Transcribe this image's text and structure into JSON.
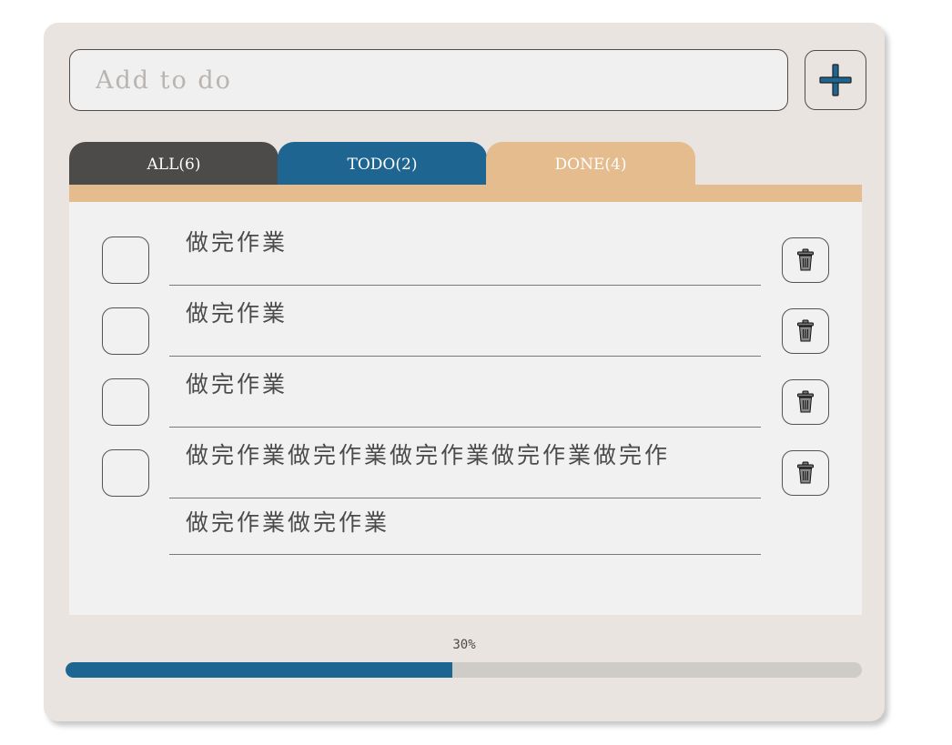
{
  "input": {
    "placeholder": "Add to do",
    "value": ""
  },
  "add_button": {
    "icon": "plus-icon"
  },
  "tabs": [
    {
      "label": "ALL(6)",
      "color": "#4d4b49"
    },
    {
      "label": "TODO(2)",
      "color": "#1e6592"
    },
    {
      "label": "DONE(4)",
      "color": "#e4bc8d"
    }
  ],
  "todos": [
    {
      "lines": [
        "做完作業"
      ],
      "checked": false
    },
    {
      "lines": [
        "做完作業"
      ],
      "checked": false
    },
    {
      "lines": [
        "做完作業"
      ],
      "checked": false
    },
    {
      "lines": [
        "做完作業做完作業做完作業做完作業做完作",
        "做完作業做完作業"
      ],
      "checked": false
    }
  ],
  "delete_icon": "trash-icon",
  "progress": {
    "label": "30%",
    "fraction": 0.486
  },
  "colors": {
    "accent": "#1e6592",
    "done": "#e4bc8d",
    "dark": "#4d4b49",
    "card": "#e9e4e0"
  }
}
